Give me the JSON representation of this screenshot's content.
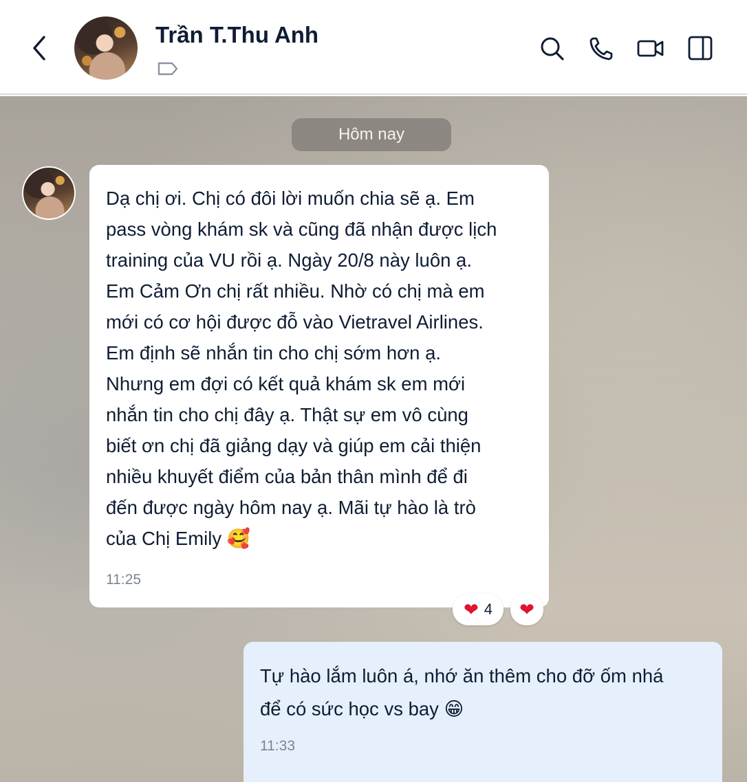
{
  "header": {
    "contact_name": "Trần T.Thu Anh",
    "icons": [
      "back-chevron-icon",
      "tag-icon",
      "search-icon",
      "phone-icon",
      "video-call-icon",
      "side-panel-icon"
    ]
  },
  "chat": {
    "date_divider": "Hôm nay",
    "incoming": {
      "text": "Dạ chị ơi. Chị có đôi lời muốn chia sẽ ạ. Em\npass vòng khám sk và cũng đã nhận được lịch\ntraining của VU rồi ạ. Ngày 20/8 này luôn ạ.\nEm Cảm Ơn chị rất nhiều. Nhờ có chị mà em\nmới có cơ hội được đỗ vào Vietravel Airlines.\nEm định sẽ nhắn tin cho chị sớm hơn ạ.\nNhưng em đợi có kết quả khám sk  em mới\nnhắn tin cho chị đây ạ. Thật sự em vô cùng\nbiết ơn chị đã giảng dạy và giúp em cải thiện\nnhiều khuyết điểm của bản thân mình để đi\nđến được ngày hôm nay ạ. Mãi tự hào là trò\ncủa Chị Emily",
      "emoji": "🥰",
      "time": "11:25",
      "reactions": {
        "heart_emoji": "❤",
        "heart_count": "4"
      }
    },
    "outgoing": {
      "text": "Tự hào lắm luôn á, nhớ ăn thêm cho đỡ ốm nhá\nđể có sức học vs bay",
      "emoji": "😁",
      "time": "11:33"
    }
  },
  "colors": {
    "accent_text": "#0f1d33",
    "outgoing_bubble": "#e6effc",
    "reaction_heart": "#e0142e"
  }
}
